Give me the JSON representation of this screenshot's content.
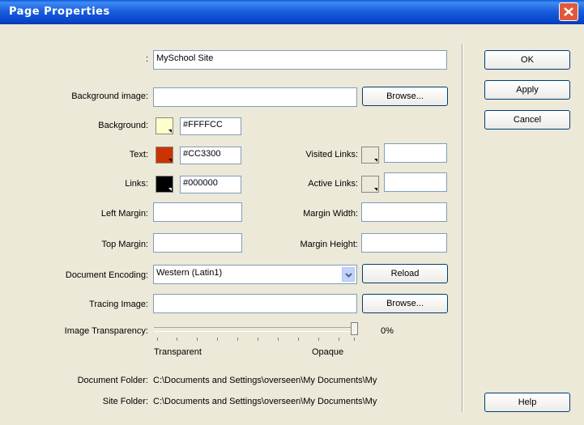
{
  "window": {
    "title": "Page Properties"
  },
  "form": {
    "title_label": ":",
    "title_value": "MySchool Site",
    "bg_image_label": "Background image:",
    "bg_image_value": "",
    "background_label": "Background:",
    "background_value": "#FFFFCC",
    "text_label": "Text:",
    "text_value": "#CC3300",
    "links_label": "Links:",
    "links_value": "#000000",
    "visited_links_label": "Visited Links:",
    "visited_links_value": "",
    "active_links_label": "Active Links:",
    "active_links_value": "",
    "left_margin_label": "Left Margin:",
    "left_margin_value": "",
    "margin_width_label": "Margin Width:",
    "margin_width_value": "",
    "top_margin_label": "Top Margin:",
    "top_margin_value": "",
    "margin_height_label": "Margin Height:",
    "margin_height_value": "",
    "encoding_label": "Document Encoding:",
    "encoding_value": "Western (Latin1)",
    "tracing_image_label": "Tracing Image:",
    "tracing_image_value": "",
    "transparency_label": "Image Transparency:",
    "transparency_value": "0%",
    "transparent_label": "Transparent",
    "opaque_label": "Opaque",
    "doc_folder_label": "Document Folder:",
    "doc_folder_value": "C:\\Documents and Settings\\overseen\\My Documents\\My",
    "site_folder_label": "Site Folder:",
    "site_folder_value": "C:\\Documents and Settings\\overseen\\My Documents\\My"
  },
  "buttons": {
    "browse1": "Browse...",
    "browse2": "Browse...",
    "reload": "Reload",
    "ok": "OK",
    "apply": "Apply",
    "cancel": "Cancel",
    "help": "Help"
  },
  "colors": {
    "background_swatch": "#FFFFCC",
    "text_swatch": "#CC3300",
    "links_swatch": "#000000",
    "visited_swatch": "#ECE9D8",
    "active_swatch": "#ECE9D8"
  }
}
